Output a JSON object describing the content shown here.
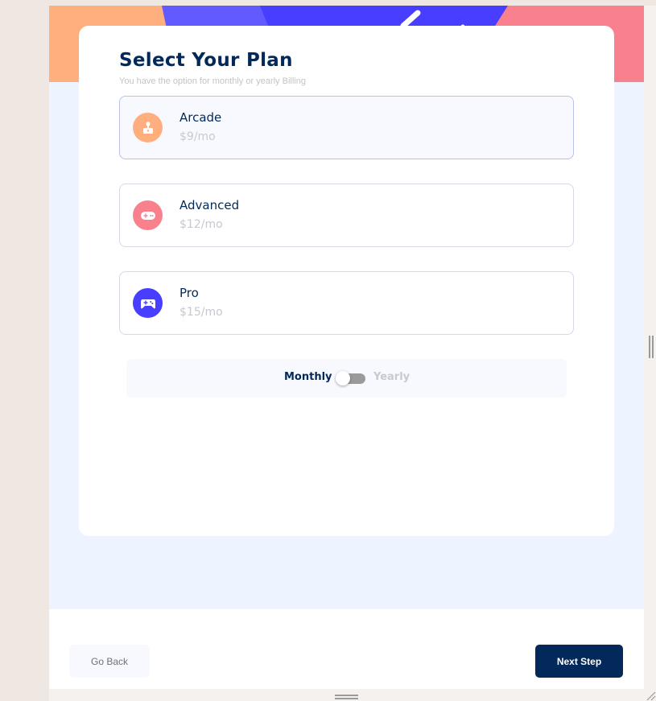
{
  "step": {
    "title": "Select Your Plan",
    "subtitle": "You have the option for monthly or yearly Billing"
  },
  "plans": [
    {
      "name": "Arcade",
      "price": "$9/mo",
      "icon": "arcade-joystick-icon",
      "icon_color": "#FFAF7E",
      "selected": true
    },
    {
      "name": "Advanced",
      "price": "$12/mo",
      "icon": "gamepad-icon",
      "icon_color": "#F9818E",
      "selected": false
    },
    {
      "name": "Pro",
      "price": "$15/mo",
      "icon": "controller-icon",
      "icon_color": "#483EFF",
      "selected": false
    }
  ],
  "billing": {
    "monthly_label": "Monthly",
    "yearly_label": "Yearly",
    "selected": "Monthly"
  },
  "footer": {
    "back_label": "Go Back",
    "next_label": "Next Step"
  },
  "colors": {
    "primary": "#022959",
    "accent_purple": "#483EFF",
    "accent_orange": "#FFAF7E",
    "accent_pink": "#F9818E",
    "background": "#EEF4FF",
    "muted_text": "#C7C9D1"
  }
}
